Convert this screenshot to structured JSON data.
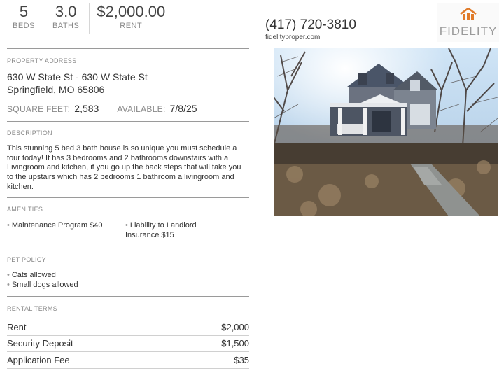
{
  "stats": {
    "beds_value": "5",
    "beds_label": "BEDS",
    "baths_value": "3.0",
    "baths_label": "BATHS",
    "rent_value": "$2,000.00",
    "rent_label": "RENT"
  },
  "contact": {
    "phone": "(417) 720-3810",
    "website": "fidelityproper.com"
  },
  "logo": {
    "wordmark": "FIDELITY",
    "accent_color": "#e07b2a"
  },
  "property": {
    "section_label": "PROPERTY ADDRESS",
    "address_line1": "630 W State St - 630 W State St",
    "address_line2": "Springfield, MO 65806",
    "sqft_label": "SQUARE FEET:",
    "sqft_value": "2,583",
    "available_label": "AVAILABLE:",
    "available_value": "7/8/25"
  },
  "description": {
    "section_label": "DESCRIPTION",
    "text": "This stunning 5 bed 3 bath house is so unique you must schedule a tour today! It has 3 bedrooms and 2 bathrooms downstairs with a Livingroom and kitchen, if you go up the back steps that will take you to the upstairs which has 2 bedrooms 1 bathroom a livingroom and kitchen."
  },
  "amenities": {
    "section_label": "AMENITIES",
    "items": [
      "Maintenance Program $40",
      "Liability to Landlord Insurance $15"
    ]
  },
  "pet_policy": {
    "section_label": "PET POLICY",
    "items": [
      "Cats allowed",
      "Small dogs allowed"
    ]
  },
  "rental_terms": {
    "section_label": "RENTAL TERMS",
    "rows": [
      {
        "label": "Rent",
        "value": "$2,000"
      },
      {
        "label": "Security Deposit",
        "value": "$1,500"
      },
      {
        "label": "Application Fee",
        "value": "$35"
      }
    ]
  }
}
